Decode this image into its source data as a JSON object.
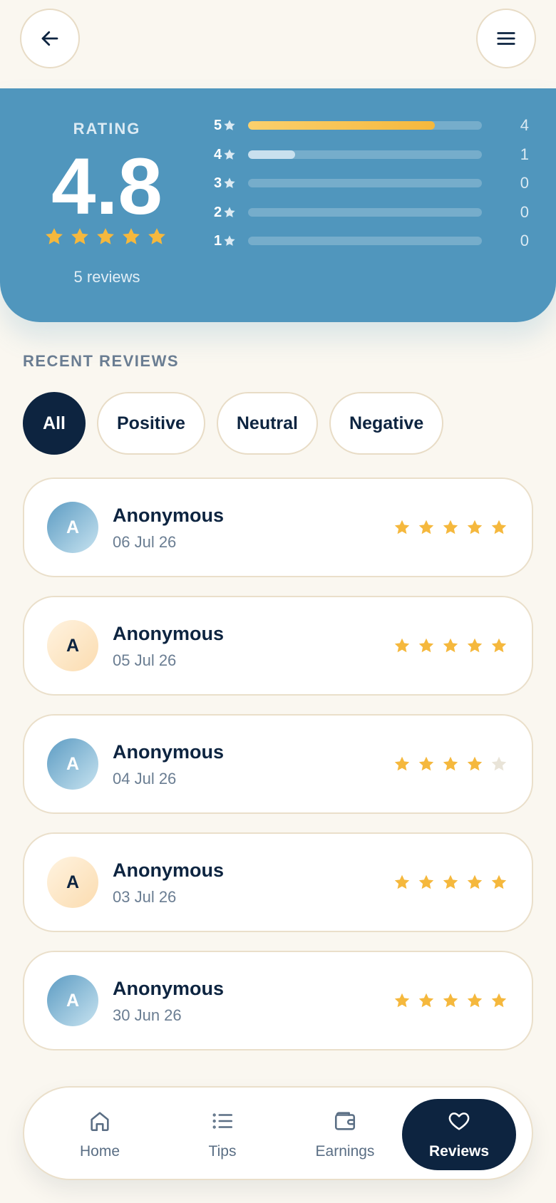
{
  "nav": {
    "back_icon": "arrow-left-icon",
    "menu_icon": "hamburger-menu-icon"
  },
  "rating": {
    "label": "RATING",
    "value": "4.8",
    "stars": 5,
    "count_text": "5 reviews",
    "distribution": [
      {
        "label": "5",
        "count": "4",
        "fraction": 0.8
      },
      {
        "label": "4",
        "count": "1",
        "fraction": 0.2
      },
      {
        "label": "3",
        "count": "0",
        "fraction": 0
      },
      {
        "label": "2",
        "count": "0",
        "fraction": 0
      },
      {
        "label": "1",
        "count": "0",
        "fraction": 0
      }
    ]
  },
  "recent": {
    "title": "RECENT REVIEWS",
    "filters": [
      "All",
      "Positive",
      "Neutral",
      "Negative"
    ],
    "active_filter": "All"
  },
  "reviews": [
    {
      "initial": "A",
      "name": "Anonymous",
      "date": "06 Jul 26",
      "rating": 5,
      "avatar": "blue"
    },
    {
      "initial": "A",
      "name": "Anonymous",
      "date": "05 Jul 26",
      "rating": 5,
      "avatar": "peach"
    },
    {
      "initial": "A",
      "name": "Anonymous",
      "date": "04 Jul 26",
      "rating": 4,
      "avatar": "blue"
    },
    {
      "initial": "A",
      "name": "Anonymous",
      "date": "03 Jul 26",
      "rating": 5,
      "avatar": "peach"
    },
    {
      "initial": "A",
      "name": "Anonymous",
      "date": "30 Jun 26",
      "rating": 5,
      "avatar": "blue"
    }
  ],
  "bottom_nav": [
    {
      "label": "Home",
      "icon": "home-icon",
      "active": false
    },
    {
      "label": "Tips",
      "icon": "list-icon",
      "active": false
    },
    {
      "label": "Earnings",
      "icon": "wallet-icon",
      "active": false
    },
    {
      "label": "Reviews",
      "icon": "heart-icon",
      "active": true
    }
  ],
  "colors": {
    "accent_navy": "#0d2440",
    "hero_blue": "#5096bd",
    "star_gold": "#f5b83d",
    "star_empty": "#e9e4d8",
    "bar_track": "#7fb1cf"
  }
}
